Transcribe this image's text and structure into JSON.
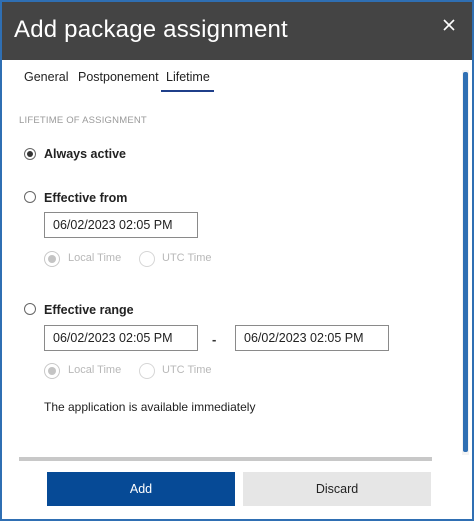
{
  "dialog": {
    "title": "Add package assignment"
  },
  "tabs": [
    {
      "label": "General"
    },
    {
      "label": "Postponement"
    },
    {
      "label": "Lifetime"
    }
  ],
  "lifetime": {
    "section_label": "LIFETIME OF ASSIGNMENT",
    "always_active_label": "Always active",
    "effective_from_label": "Effective from",
    "effective_from_value": "06/02/2023 02:05 PM",
    "effective_range_label": "Effective range",
    "range_start_value": "06/02/2023 02:05 PM",
    "range_separator": "-",
    "range_end_value": "06/02/2023 02:05 PM",
    "local_time_label": "Local Time",
    "utc_time_label": "UTC Time",
    "info_text": "The application is available immediately"
  },
  "footer": {
    "add_label": "Add",
    "discard_label": "Discard"
  }
}
